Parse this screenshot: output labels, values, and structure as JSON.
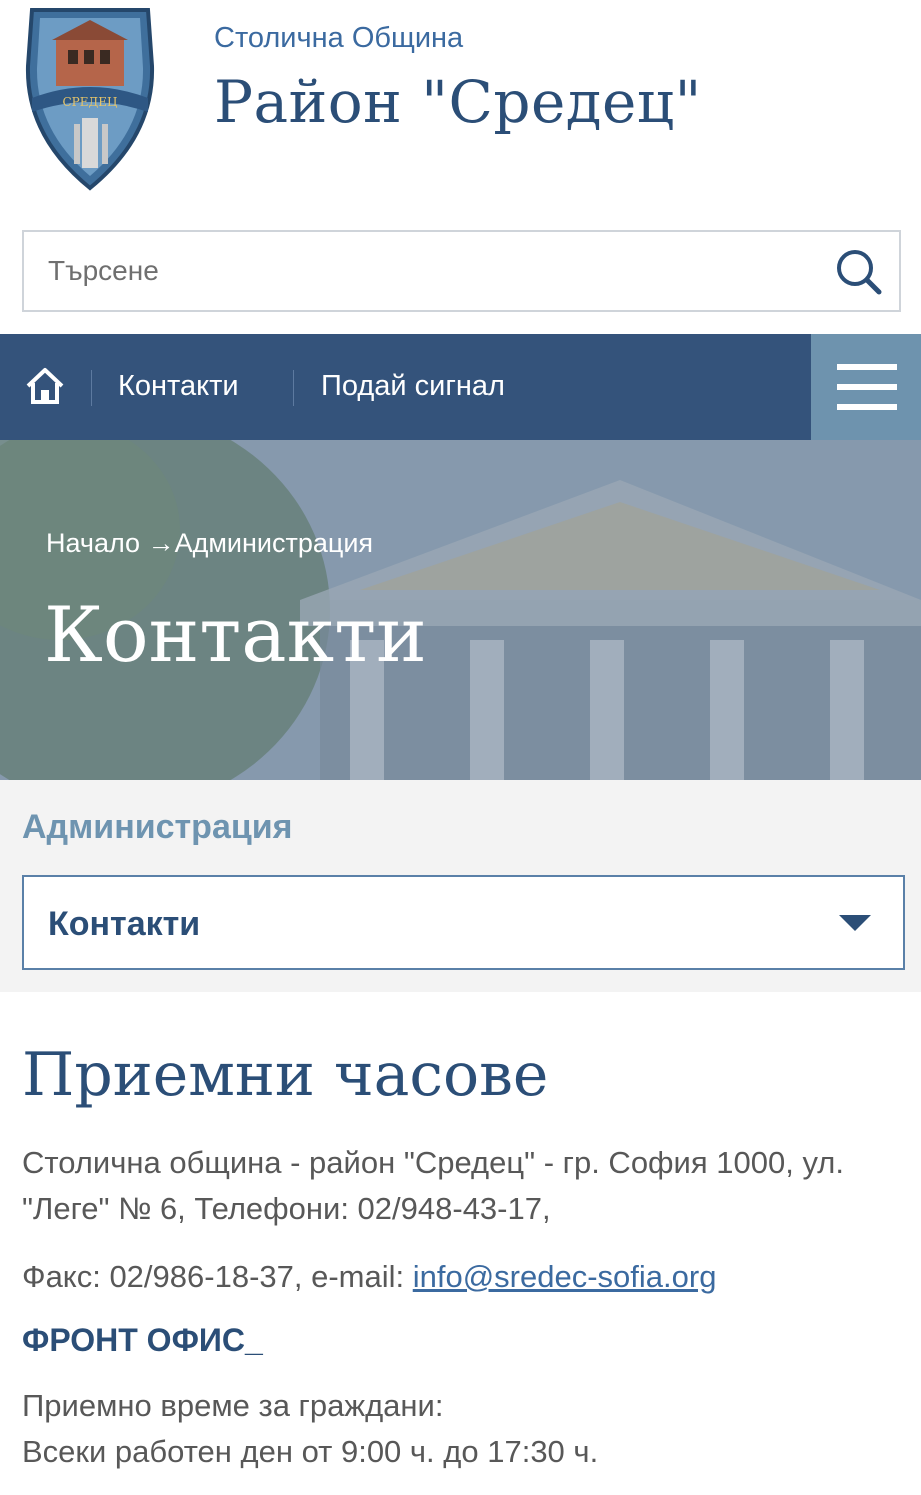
{
  "header": {
    "municipality": "Столична Община",
    "district": "Район \"Средец\"",
    "crest_text": "СРЕДЕЦ"
  },
  "search": {
    "placeholder": "Търсене"
  },
  "nav": {
    "items": [
      {
        "label": "Контакти"
      },
      {
        "label": "Подай сигнал"
      }
    ]
  },
  "hero": {
    "breadcrumb": "Начало →Администрация",
    "title": "Контакти"
  },
  "section": {
    "label": "Администрация",
    "selected": "Контакти"
  },
  "content": {
    "heading": "Приемни часове",
    "address": "Столична община - район \"Средец\" - гр. София 1000, ул. \"Леге\" № 6, Телефони: 02/948-43-17,",
    "fax_prefix": "Факс: 02/986-18-37, e-mail: ",
    "email": "info@sredec-sofia.org",
    "front_office": "ФРОНТ ОФИС",
    "front_office_suffix": "_",
    "hours_title": "Приемно време за граждани:",
    "hours_text": "Всеки работен ден от 9:00 ч. до 17:30 ч."
  },
  "colors": {
    "nav_bg": "#34537b",
    "burger_bg": "#6e93ae",
    "accent": "#2b4e77",
    "link": "#3b6aa0"
  }
}
